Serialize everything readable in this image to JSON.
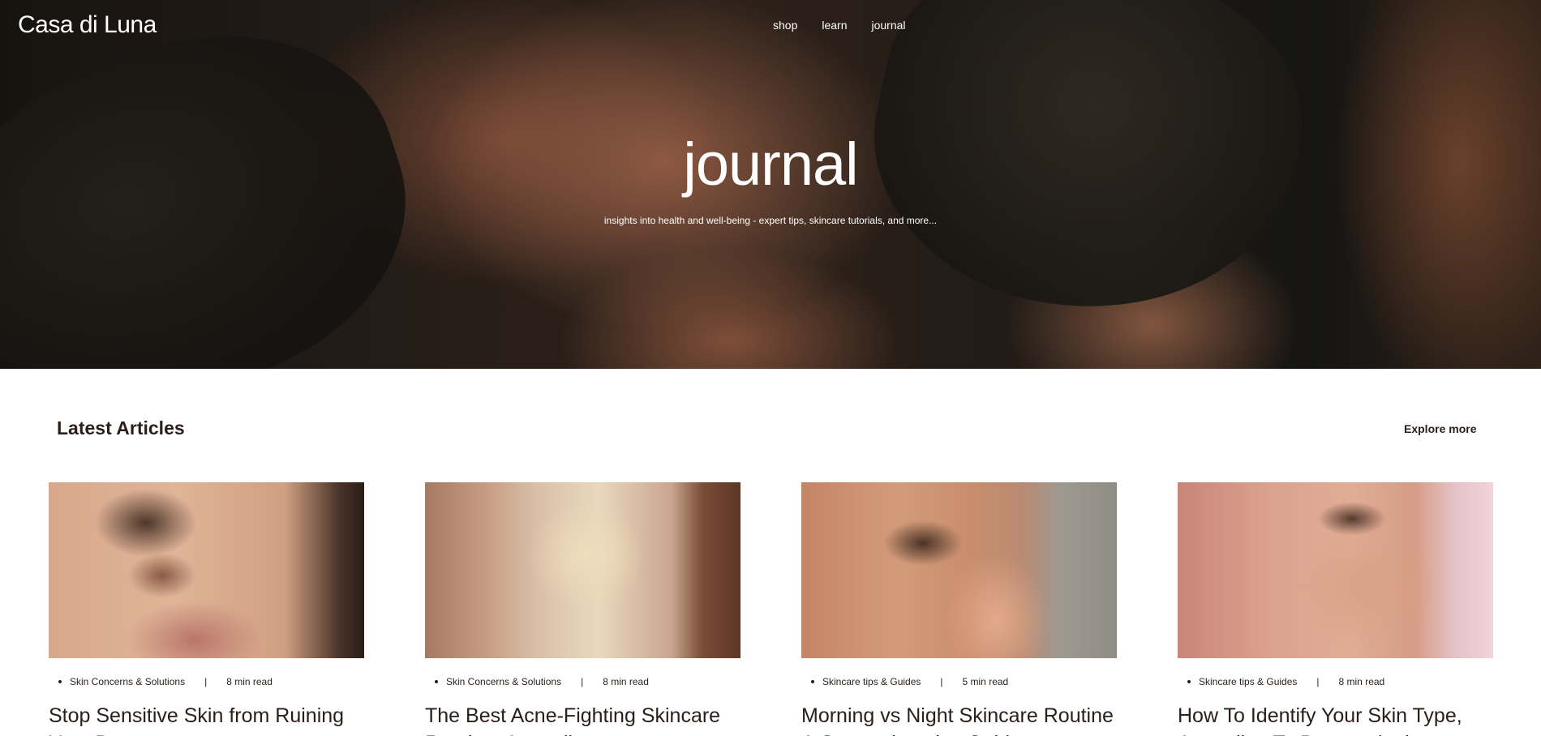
{
  "header": {
    "logo": "Casa di Luna",
    "nav": [
      "shop",
      "learn",
      "journal"
    ]
  },
  "hero": {
    "title": "journal",
    "subtitle": "insights into health and well-being - expert tips, skincare tutorials, and more..."
  },
  "latest": {
    "heading": "Latest Articles",
    "explore_label": "Explore more",
    "articles": [
      {
        "category": "Skin Concerns & Solutions",
        "separator": "|",
        "read_time": "8 min read",
        "title": "Stop Sensitive Skin from Ruining Your Day"
      },
      {
        "category": "Skin Concerns & Solutions",
        "separator": "|",
        "read_time": "8 min read",
        "title": "The Best Acne-Fighting Skincare Routine, According to"
      },
      {
        "category": "Skincare tips & Guides",
        "separator": "|",
        "read_time": "5 min read",
        "title": "Morning vs Night Skincare Routine A Comprehensive Guide"
      },
      {
        "category": "Skincare tips & Guides",
        "separator": "|",
        "read_time": "8 min read",
        "title": "How To Identify Your Skin Type, According To Dermatologists"
      }
    ]
  }
}
